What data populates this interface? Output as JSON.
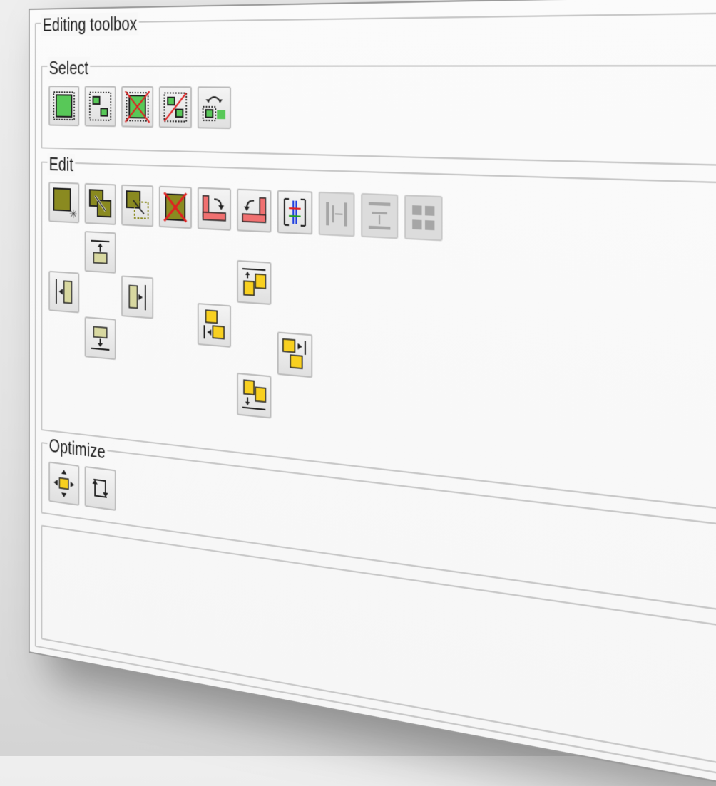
{
  "toolbox": {
    "title": "Editing toolbox",
    "groups": {
      "select": {
        "label": "Select"
      },
      "edit": {
        "label": "Edit"
      },
      "optimize": {
        "label": "Optimize"
      }
    }
  },
  "colors": {
    "select_green": "#58c858",
    "edit_olive": "#8a8a20",
    "delete_red": "#e02020",
    "pink": "#f07070",
    "align_beige": "#d8d8a0",
    "distribute_yellow": "#f8d020",
    "disabled_gray": "#a6a6a6"
  }
}
